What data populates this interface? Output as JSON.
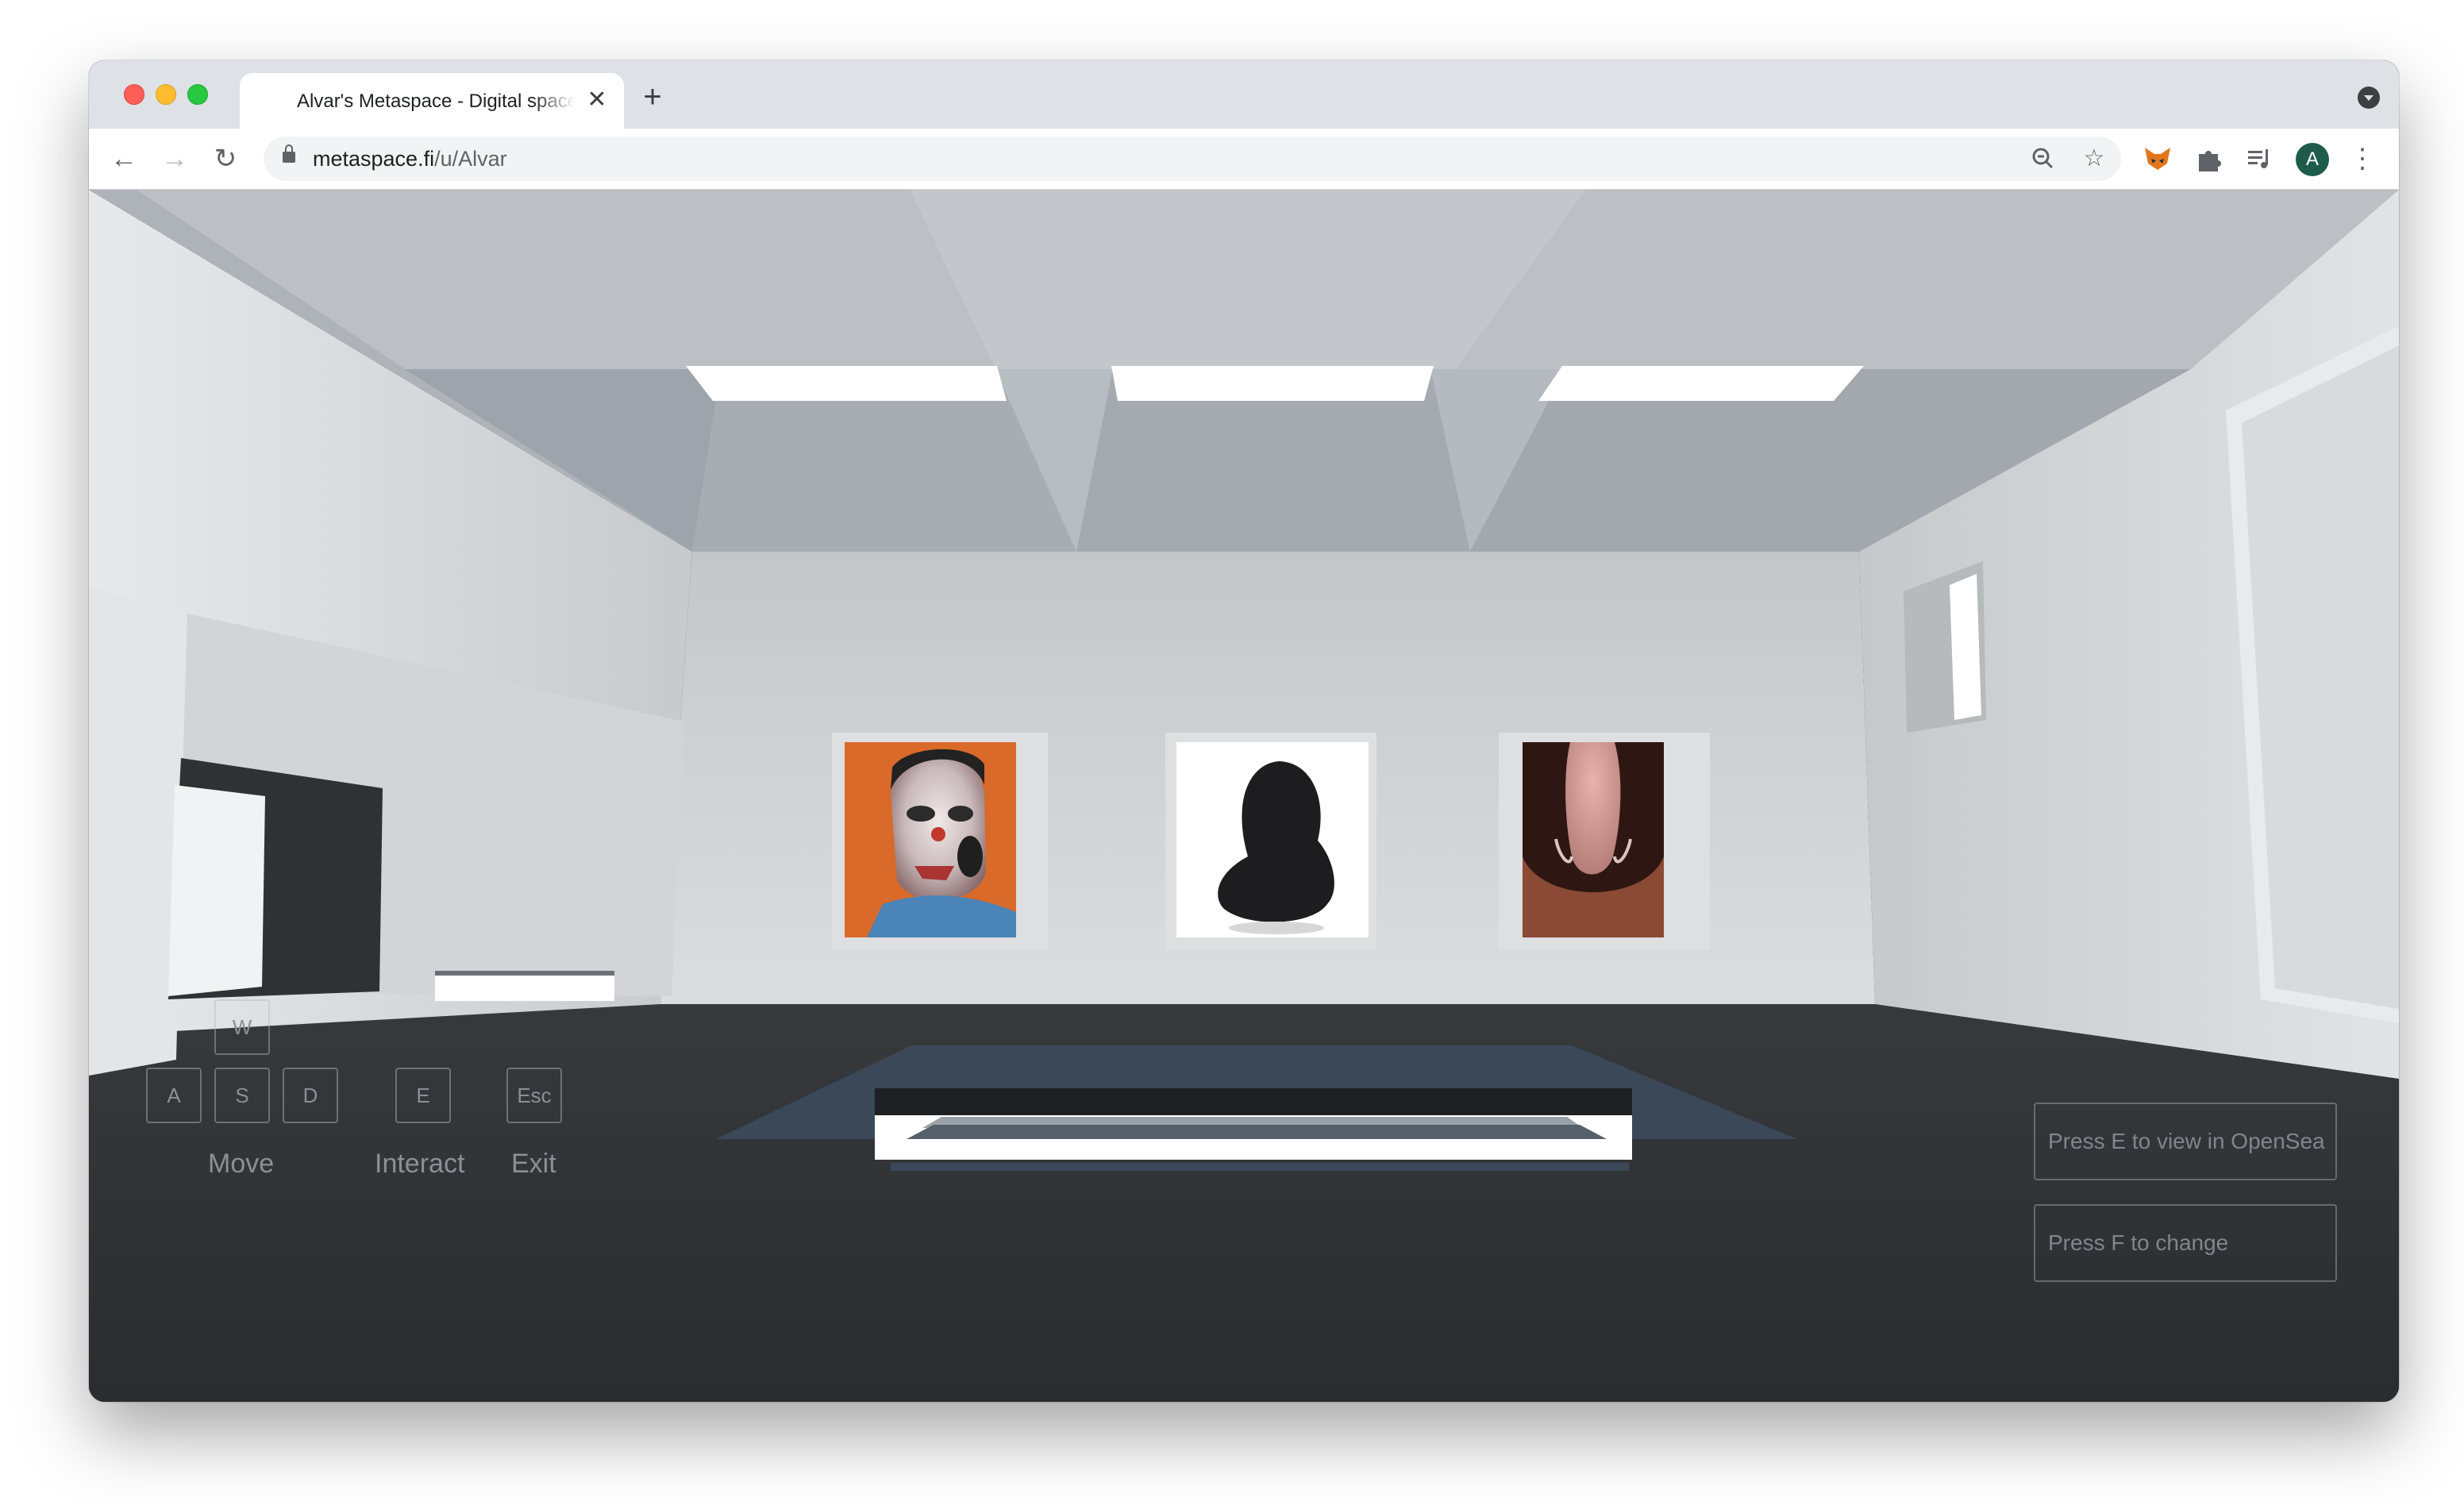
{
  "browser": {
    "tab_title": "Alvar's Metaspace - Digital space",
    "tab_close_icon": "close-icon",
    "new_tab_label": "+",
    "url_host": "metaspace.fi",
    "url_path": "/u/Alvar",
    "avatar_letter": "A",
    "icons": [
      "back-icon",
      "forward-icon",
      "reload-icon",
      "lock-icon",
      "zoom-icon",
      "star-icon",
      "fox-extension-icon",
      "puzzle-icon",
      "media-icon",
      "menu-icon",
      "tab-search-icon"
    ]
  },
  "hud": {
    "keys": {
      "w": "W",
      "a": "A",
      "s": "S",
      "d": "D",
      "e": "E",
      "esc": "Esc"
    },
    "labels": {
      "move": "Move",
      "interact": "Interact",
      "exit": "Exit"
    },
    "prompts": {
      "opensea": "Press E to view in OpenSea",
      "change": "Press F to change"
    }
  },
  "scene": {
    "artworks": [
      "portrait-painting",
      "hooded-figure-painting",
      "face-painting"
    ],
    "colors": {
      "floor": "#2c2e31",
      "ceiling": "#b4b9bf",
      "wall": "#cfd1d4",
      "light": "#ffffff",
      "accent": "#3d4f63"
    }
  }
}
